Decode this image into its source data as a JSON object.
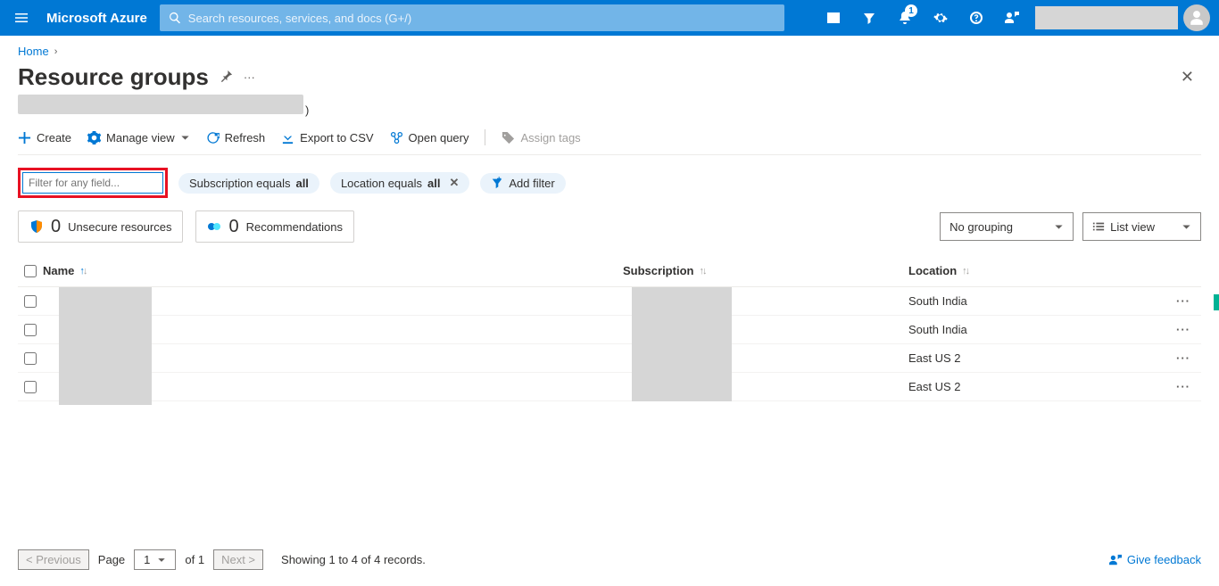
{
  "header": {
    "brand": "Microsoft Azure",
    "search_placeholder": "Search resources, services, and docs (G+/)",
    "notification_count": "1"
  },
  "breadcrumb": {
    "home": "Home"
  },
  "title": "Resource groups",
  "toolbar": {
    "create": "Create",
    "manage_view": "Manage view",
    "refresh": "Refresh",
    "export_csv": "Export to CSV",
    "open_query": "Open query",
    "assign_tags": "Assign tags"
  },
  "filters": {
    "input_placeholder": "Filter for any field...",
    "sub_prefix": "Subscription equals ",
    "sub_value": "all",
    "loc_prefix": "Location equals ",
    "loc_value": "all",
    "add": "Add filter"
  },
  "cards": {
    "unsecure_count": "0",
    "unsecure_label": "Unsecure resources",
    "rec_count": "0",
    "rec_label": "Recommendations"
  },
  "view": {
    "grouping": "No grouping",
    "mode": "List view"
  },
  "columns": {
    "name": "Name",
    "subscription": "Subscription",
    "location": "Location"
  },
  "rows": [
    {
      "location": "South India"
    },
    {
      "location": "South India"
    },
    {
      "location": "East US 2"
    },
    {
      "location": "East US 2"
    }
  ],
  "footer": {
    "prev": "< Previous",
    "page_label": "Page",
    "page_num": "1",
    "of": "of 1",
    "next": "Next >",
    "showing": "Showing 1 to 4 of 4 records.",
    "feedback": "Give feedback"
  }
}
